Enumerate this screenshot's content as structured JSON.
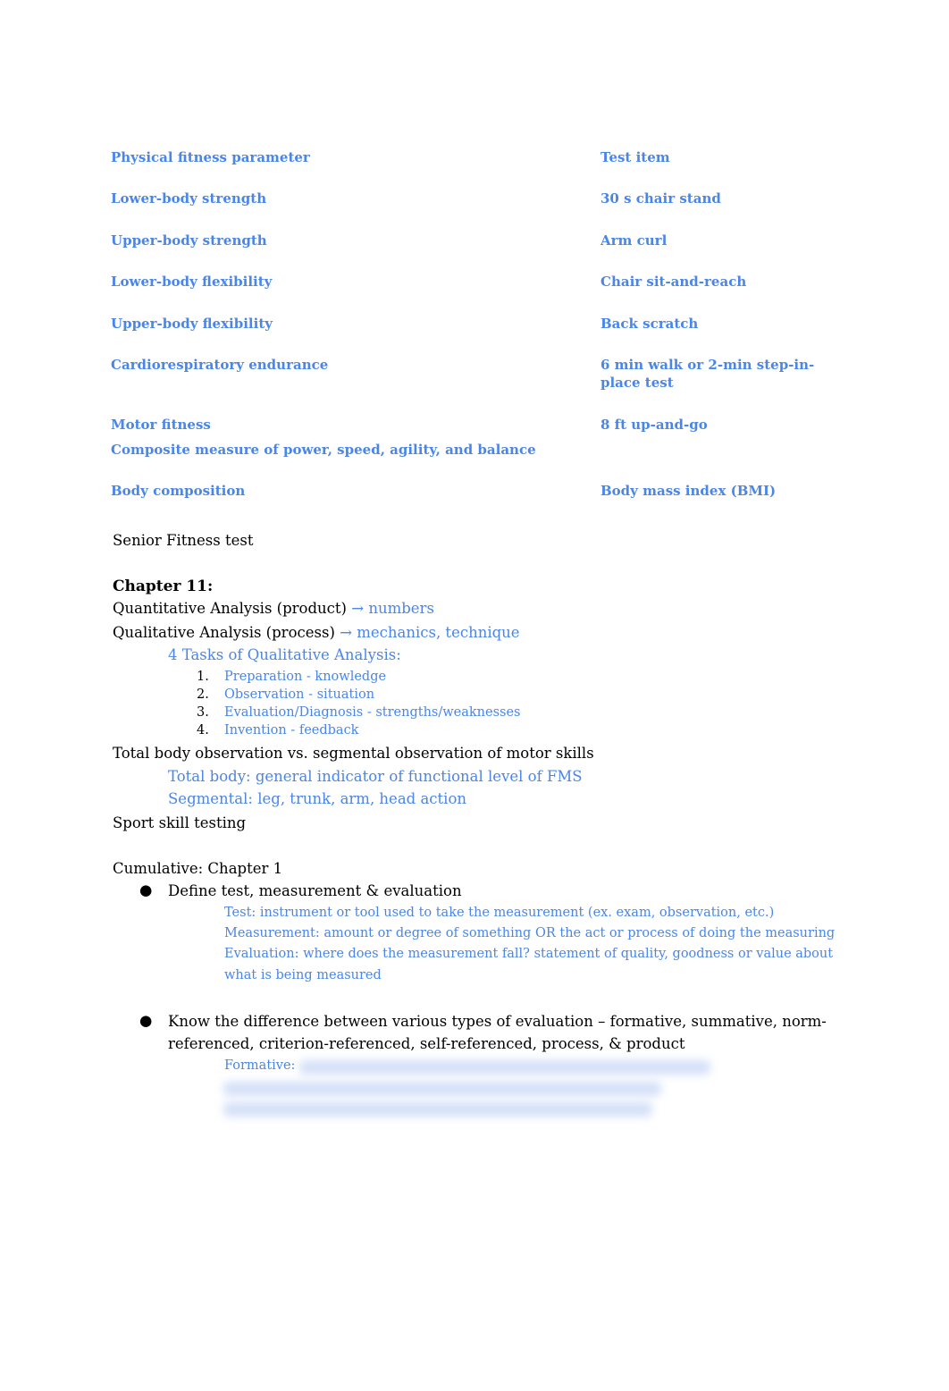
{
  "table": {
    "header": [
      "Physical fitness parameter",
      "Test item"
    ],
    "rows": [
      [
        "Lower-body strength",
        "30 s chair stand"
      ],
      [
        "Upper-body strength",
        "Arm curl"
      ],
      [
        "Lower-body flexibility",
        "Chair sit-and-reach"
      ],
      [
        "Upper-body flexibility",
        "Back scratch"
      ],
      [
        "Cardiorespiratory endurance",
        "6 min walk or 2-min step-in-",
        "place test"
      ],
      [
        "Motor fitness",
        "8 ft up-and-go",
        "Composite measure of power, speed, agility, and balance"
      ],
      [
        "Body composition",
        "Body mass index (BMI)"
      ]
    ]
  },
  "caption": "Senior Fitness test",
  "chapter11": {
    "title": "Chapter 11:",
    "quant": "Quantitative Analysis (product)",
    "quant_arrow": "→",
    "quant_note": "numbers",
    "qual": "Qualitative Analysis (process)",
    "qual_arrow": "→",
    "qual_note": "mechanics, technique",
    "tasks_title": "4 Tasks of Qualitative Analysis:",
    "tasks": [
      [
        "1.",
        "Preparation - knowledge"
      ],
      [
        "2.",
        "Observation - situation"
      ],
      [
        "3.",
        "Evaluation/Diagnosis - strengths/weaknesses"
      ],
      [
        "4.",
        "Invention - feedback"
      ]
    ],
    "obs": "Total body observation vs. segmental observation of motor skills",
    "total": "Total body: general indicator of functional level of FMS",
    "seg": "Segmental: leg, trunk, arm, head action",
    "sport": "Sport skill testing"
  },
  "cumulative": {
    "title": "Cumulative: Chapter 1",
    "bullet1": "Define test, measurement & evaluation",
    "defs": [
      "Test: instrument or tool used to take the measurement (ex. exam, observation, etc.)",
      "Measurement: amount or degree of something OR the act or process of doing the measuring",
      "Evaluation: where does the measurement fall? statement of quality, goodness or value about",
      "what is being measured"
    ],
    "bullet2a": "Know the difference between various types of evaluation – formative, summative, norm-",
    "bullet2b": "referenced, criterion-referenced, self-referenced, process, & product",
    "formative": "Formative:"
  }
}
